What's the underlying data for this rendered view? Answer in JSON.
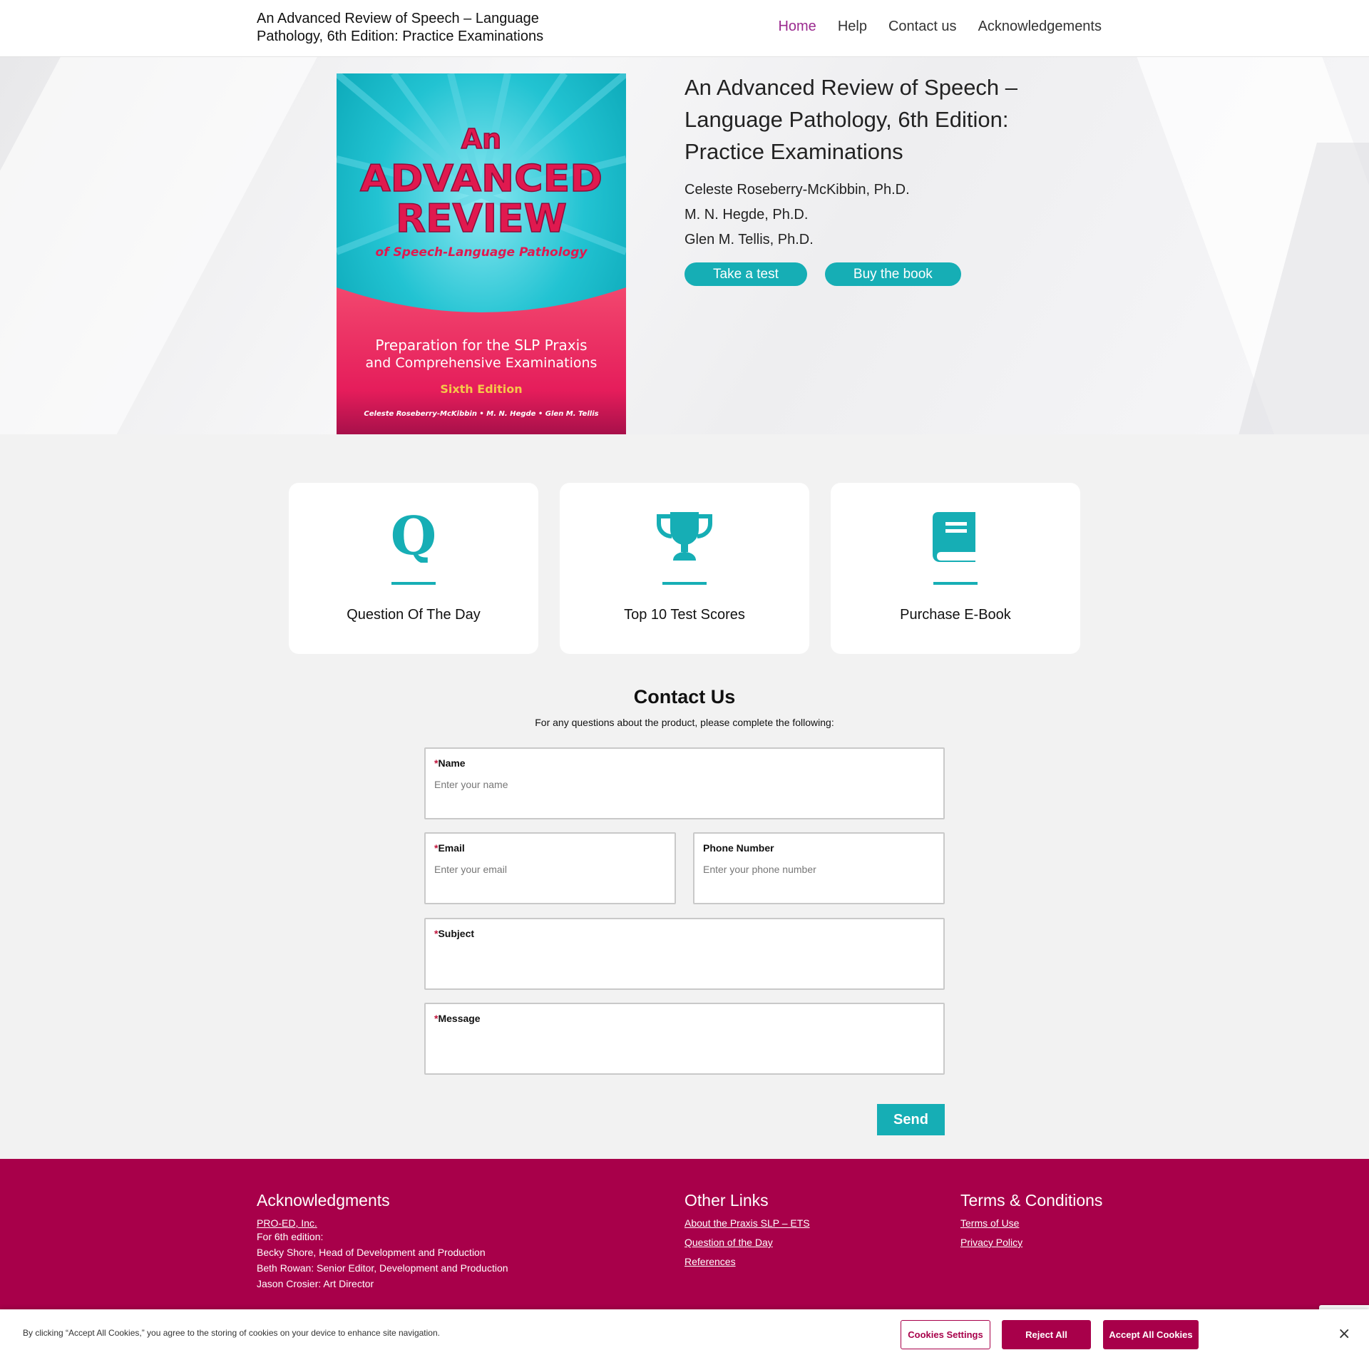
{
  "header": {
    "site_title": "An Advanced Review of Speech – Language Pathology, 6th Edition: Practice Examinations",
    "nav": [
      "Home",
      "Help",
      "Contact us",
      "Acknowledgements"
    ]
  },
  "hero": {
    "cover": {
      "line1": "An",
      "line2": "ADVANCED",
      "line3": "REVIEW",
      "line4": "of Speech-Language Pathology",
      "prep1": "Preparation for the SLP Praxis",
      "prep2": "and Comprehensive Examinations",
      "edition": "Sixth Edition",
      "authors": "Celeste Roseberry-McKibbin • M. N. Hegde • Glen M. Tellis"
    },
    "title": "An Advanced Review of Speech – Language Pathology, 6th Edition: Practice Examinations",
    "authors": [
      "Celeste Roseberry-McKibbin, Ph.D.",
      "M. N. Hegde, Ph.D.",
      "Glen M. Tellis, Ph.D."
    ],
    "take_test": "Take a test",
    "buy_book": "Buy the book"
  },
  "cards": [
    {
      "icon": "q-icon",
      "label": "Question Of The Day"
    },
    {
      "icon": "trophy-icon",
      "label": "Top 10 Test Scores"
    },
    {
      "icon": "book-icon",
      "label": "Purchase E-Book"
    }
  ],
  "contact": {
    "heading": "Contact Us",
    "subtitle": "For any questions about the product, please complete the following:",
    "fields": {
      "name": {
        "label": "Name",
        "placeholder": "Enter your name"
      },
      "email": {
        "label": "Email",
        "placeholder": "Enter your email"
      },
      "phone": {
        "label": "Phone Number",
        "placeholder": "Enter your phone number"
      },
      "subject": {
        "label": "Subject",
        "placeholder": ""
      },
      "message": {
        "label": "Message",
        "placeholder": ""
      }
    },
    "required_mark": "*",
    "send": "Send"
  },
  "footer": {
    "ack_title": "Acknowledgments",
    "ack_link": "PRO-ED, Inc.",
    "ack_lines": [
      "For 6th edition:",
      "Becky Shore, Head of Development and Production",
      "Beth Rowan: Senior Editor, Development and Production",
      "Jason Crosier: Art Director"
    ],
    "other_title": "Other Links",
    "other_links": [
      "About the Praxis SLP – ETS",
      "Question of the Day",
      "References"
    ],
    "terms_title": "Terms & Conditions",
    "terms_links": [
      "Terms of Use",
      "Privacy Policy"
    ]
  },
  "cookie": {
    "text": "By clicking “Accept All Cookies,” you agree to the storing of cookies on your device to enhance site navigation.",
    "settings": "Cookies Settings",
    "reject": "Reject All",
    "accept": "Accept All Cookies",
    "close": "×"
  },
  "colors": {
    "accent_teal": "#16aeb5",
    "brand_magenta": "#a8004a",
    "nav_active": "#9b2a8f"
  }
}
